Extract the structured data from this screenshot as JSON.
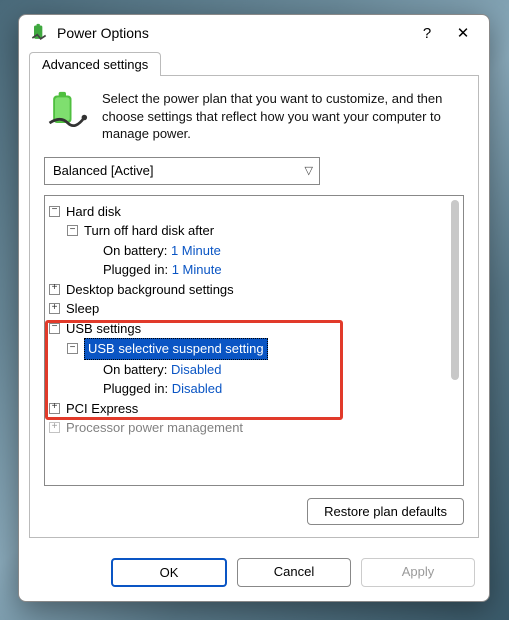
{
  "window": {
    "title": "Power Options",
    "help_glyph": "?",
    "close_glyph": "✕"
  },
  "tab": {
    "label": "Advanced settings"
  },
  "intro": {
    "text": "Select the power plan that you want to customize, and then choose settings that reflect how you want your computer to manage power."
  },
  "plan": {
    "selected": "Balanced [Active]"
  },
  "tree": {
    "hard_disk": "Hard disk",
    "turn_off": "Turn off hard disk after",
    "hd_batt_label": "On battery:",
    "hd_batt_val": "1 Minute",
    "hd_plug_label": "Plugged in:",
    "hd_plug_val": "1 Minute",
    "desktop_bg": "Desktop background settings",
    "sleep": "Sleep",
    "usb": "USB settings",
    "usb_sel": "USB selective suspend setting",
    "usb_batt_label": "On battery:",
    "usb_batt_val": "Disabled",
    "usb_plug_label": "Plugged in:",
    "usb_plug_val": "Disabled",
    "pci": "PCI Express",
    "proc": "Processor power management"
  },
  "buttons": {
    "restore": "Restore plan defaults",
    "ok": "OK",
    "cancel": "Cancel",
    "apply": "Apply"
  }
}
